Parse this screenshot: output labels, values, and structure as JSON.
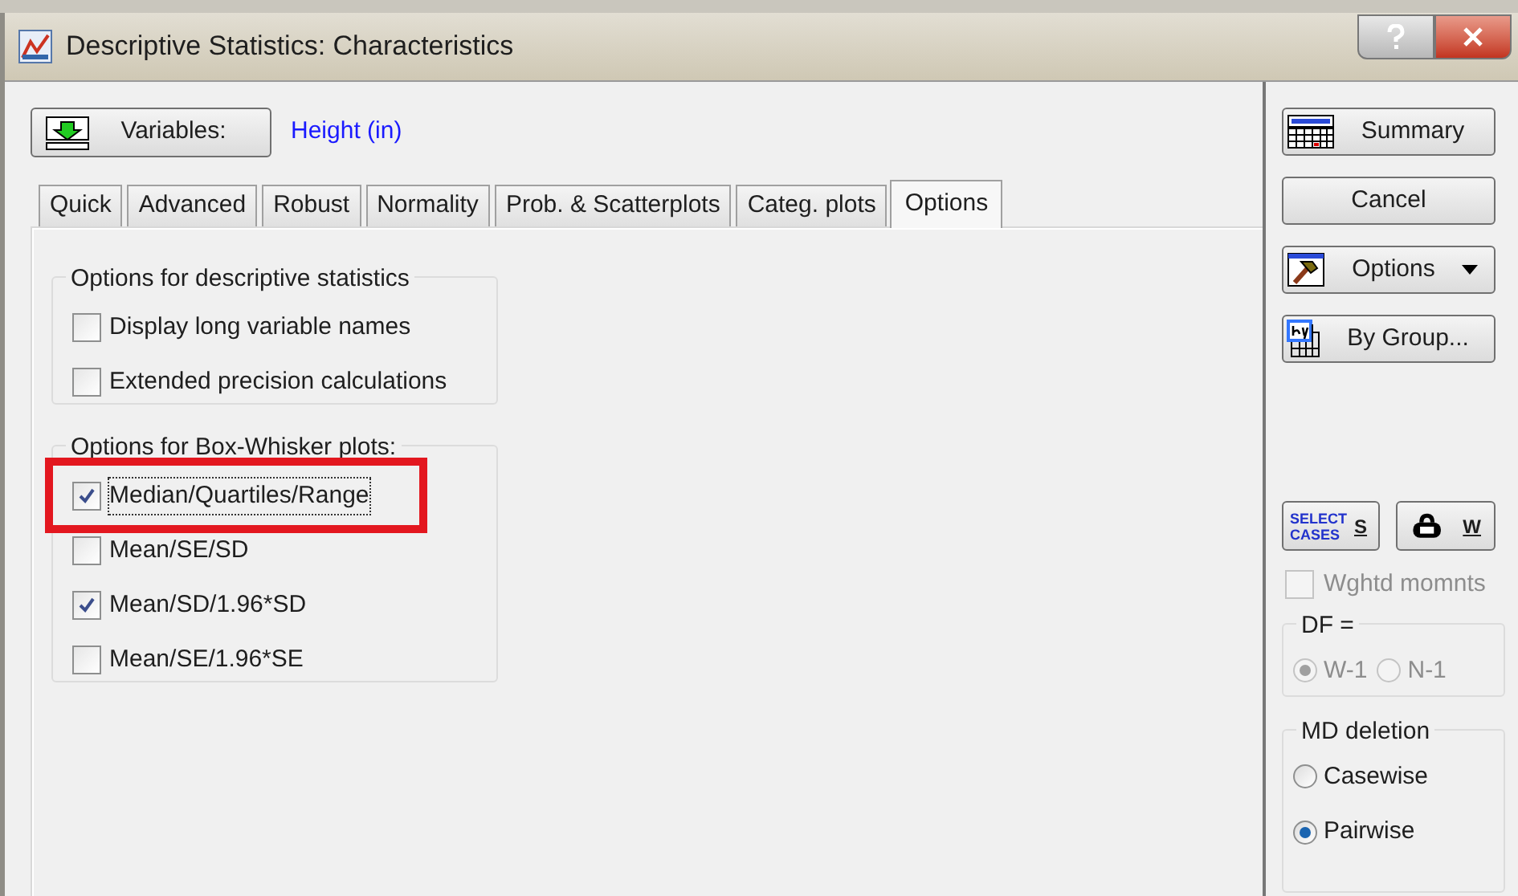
{
  "window": {
    "title": "Descriptive Statistics: Characteristics"
  },
  "variables": {
    "button_label": "Variables:",
    "value": "Height (in)"
  },
  "tabs": [
    {
      "label": "Quick",
      "selected": false
    },
    {
      "label": "Advanced",
      "selected": false
    },
    {
      "label": "Robust",
      "selected": false
    },
    {
      "label": "Normality",
      "selected": false
    },
    {
      "label": "Prob. & Scatterplots",
      "selected": false
    },
    {
      "label": "Categ. plots",
      "selected": false
    },
    {
      "label": "Options",
      "selected": true
    }
  ],
  "groups": [
    {
      "title": "Options for descriptive statistics",
      "options": [
        {
          "label": "Display long variable names",
          "checked": false,
          "highlighted": false
        },
        {
          "label": "Extended precision calculations",
          "checked": false,
          "highlighted": false
        }
      ]
    },
    {
      "title": "Options for Box-Whisker plots:",
      "options": [
        {
          "label": "Median/Quartiles/Range",
          "checked": true,
          "highlighted": true
        },
        {
          "label": "Mean/SE/SD",
          "checked": false,
          "highlighted": false
        },
        {
          "label": "Mean/SD/1.96*SD",
          "checked": true,
          "highlighted": false
        },
        {
          "label": "Mean/SE/1.96*SE",
          "checked": false,
          "highlighted": false
        }
      ]
    }
  ],
  "side_buttons": [
    {
      "kind": "summary",
      "label": "Summary"
    },
    {
      "kind": "plain",
      "label": "Cancel"
    },
    {
      "kind": "options",
      "label": "Options"
    },
    {
      "kind": "bygroup",
      "label": "By Group..."
    }
  ],
  "select_cases": {
    "icon_text": "SELECT CASES",
    "key": "S"
  },
  "weight": {
    "key": "W"
  },
  "wghtd_momnts": {
    "label": "Wghtd momnts",
    "checked": false,
    "disabled": true
  },
  "df": {
    "title": "DF =",
    "options": [
      {
        "label": "W-1",
        "selected": true,
        "disabled": true
      },
      {
        "label": "N-1",
        "selected": false,
        "disabled": true
      }
    ]
  },
  "md_deletion": {
    "title": "MD deletion",
    "options": [
      {
        "label": "Casewise",
        "selected": false,
        "disabled": false
      },
      {
        "label": "Pairwise",
        "selected": true,
        "disabled": false
      }
    ]
  }
}
